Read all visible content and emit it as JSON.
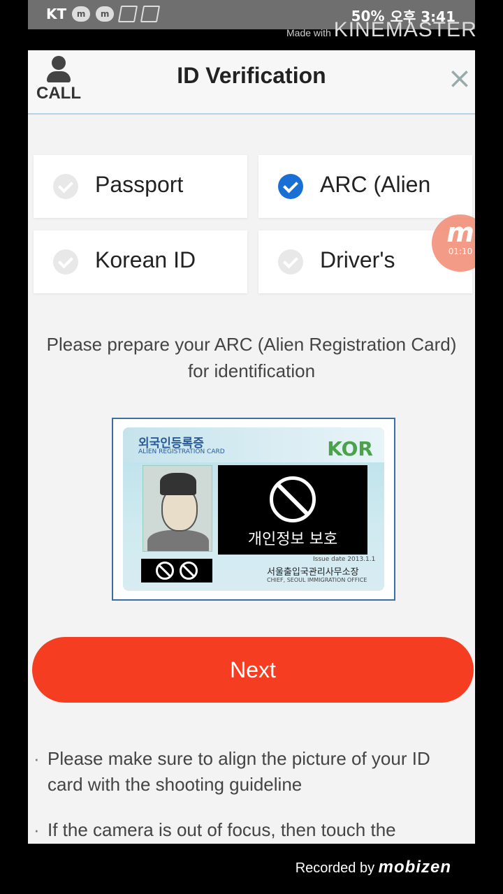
{
  "statusbar": {
    "carrier": "KT",
    "battery": "50%",
    "time": "오후 3:41"
  },
  "overlay": {
    "made_with": "Made with",
    "kinemaster": "KINEMASTER",
    "recorded_by": "Recorded by",
    "mobizen": "mobizen",
    "float_time": "01:10",
    "float_letter": "m"
  },
  "header": {
    "call_label": "CALL",
    "title": "ID Verification",
    "close": "×"
  },
  "options": [
    {
      "label": "Passport",
      "selected": false
    },
    {
      "label": "ARC (Alien",
      "selected": true
    },
    {
      "label": "Korean ID",
      "selected": false
    },
    {
      "label": "Driver's",
      "selected": false
    }
  ],
  "instruction": "Please prepare your ARC (Alien Registration Card) for identification",
  "card": {
    "title_kr": "외국인등록증",
    "title_en": "ALIEN REGISTRATION CARD",
    "country": "KOR",
    "privacy_text": "개인정보 보호",
    "issuer_kr": "서울출입국관리사무소장",
    "issuer_en": "CHIEF, SEOUL IMMIGRATION OFFICE",
    "issue_date": "Issue date  2013.1.1"
  },
  "next_label": "Next",
  "notes": [
    "Please make sure to align the picture of your ID card with the shooting guideline",
    "If the camera is out of focus, then touch the"
  ]
}
